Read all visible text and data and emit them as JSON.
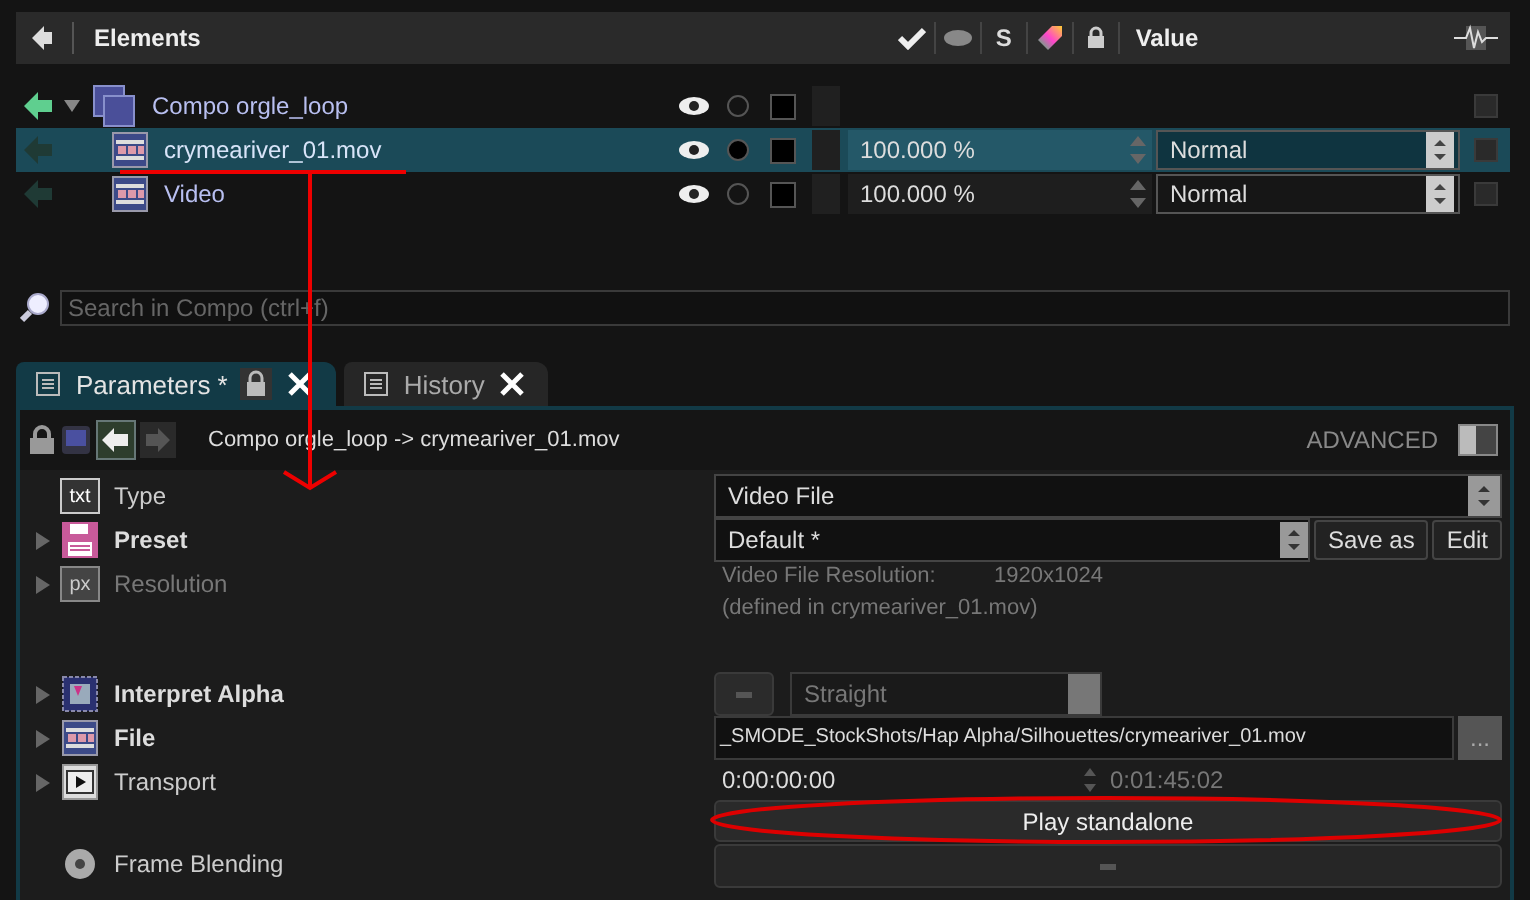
{
  "elements_panel": {
    "header": {
      "title": "Elements",
      "column_s": "S",
      "value_label": "Value"
    },
    "items": [
      {
        "name": "Compo orgle_loop",
        "kind": "compo",
        "expanded": true,
        "selected": false,
        "children": [
          {
            "name": "crymeariver_01.mov",
            "kind": "video",
            "selected": true,
            "opacity": "100.000 %",
            "blend": "Normal"
          },
          {
            "name": "Video",
            "kind": "video",
            "selected": false,
            "opacity": "100.000 %",
            "blend": "Normal"
          }
        ]
      }
    ]
  },
  "search": {
    "placeholder": "Search in Compo (ctrl+f)"
  },
  "tabs": [
    {
      "label": "Parameters *",
      "selected": true,
      "locked": true
    },
    {
      "label": "History",
      "selected": false,
      "locked": false
    }
  ],
  "breadcrumb": "Compo orgle_loop -> crymeariver_01.mov",
  "advanced": {
    "label": "ADVANCED",
    "on": false
  },
  "parameters": [
    {
      "label": "Type",
      "kind": "type",
      "icon_text": "txt",
      "bold": false,
      "disabled": false,
      "expandable": false,
      "value": "Video File"
    },
    {
      "label": "Preset",
      "kind": "preset",
      "bold": true,
      "disabled": false,
      "expandable": true,
      "value": "Default *",
      "buttons": [
        "Save as",
        "Edit"
      ]
    },
    {
      "label": "Resolution",
      "kind": "resolution",
      "icon_text": "px",
      "bold": false,
      "disabled": true,
      "expandable": true,
      "info_label": "Video File Resolution:",
      "info_value": "1920x1024",
      "note": "(defined in crymeariver_01.mov)"
    },
    {
      "label": "Interpret Alpha",
      "kind": "alpha",
      "bold": true,
      "disabled": false,
      "expandable": true,
      "value": "Straight",
      "select_disabled": true
    },
    {
      "label": "File",
      "kind": "file",
      "bold": true,
      "disabled": false,
      "expandable": true,
      "value": "_SMODE_StockShots/Hap Alpha/Silhouettes/crymeariver_01.mov",
      "browse": "..."
    },
    {
      "label": "Transport",
      "kind": "transport",
      "bold": false,
      "disabled": false,
      "expandable": true,
      "time": "0:00:00:00",
      "duration": "0:01:45:02",
      "button": "Play standalone"
    },
    {
      "label": "Frame Blending",
      "kind": "blending",
      "bold": false,
      "disabled": false,
      "expandable": false
    }
  ]
}
